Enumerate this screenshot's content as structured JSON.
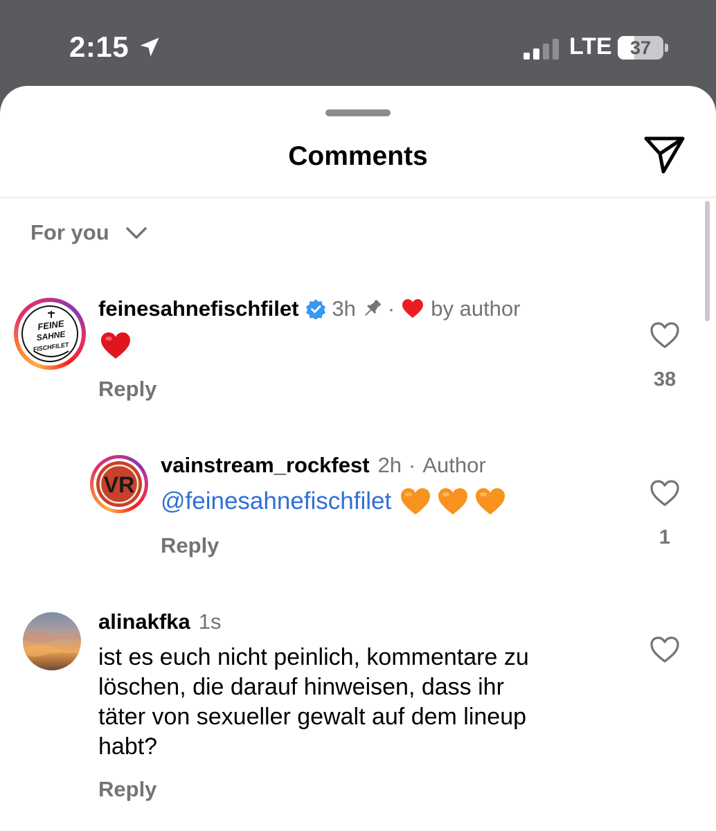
{
  "status_bar": {
    "time": "2:15",
    "location_icon": "location-arrow-icon",
    "signal_icon": "cellular-signal-icon",
    "signal_bars_active": 2,
    "network": "LTE",
    "battery_level": "37",
    "battery_fraction": 0.37
  },
  "sheet": {
    "title": "Comments",
    "share_icon": "paper-plane-icon",
    "sort_label": "For you",
    "sort_icon": "chevron-down-icon"
  },
  "comments": [
    {
      "username": "feinesahnefischfilet",
      "verified": true,
      "time": "3h",
      "pinned": true,
      "separator": "·",
      "liked_by_author_label": "by author",
      "text_emoji": "heart-red",
      "reply_label": "Reply",
      "like_count": "38",
      "avatar_logo_lines": [
        "FEINE",
        "SAHNE",
        "FISCHFILET"
      ],
      "replies": [
        {
          "username": "vainstream_rockfest",
          "time": "2h",
          "separator": "·",
          "badge": "Author",
          "mention": "@feinesahnefischfilet",
          "emojis": [
            "orange-heart",
            "orange-heart",
            "orange-heart"
          ],
          "reply_label": "Reply",
          "like_count": "1",
          "avatar_logo": "VR"
        }
      ]
    },
    {
      "username": "alinakfka",
      "time": "1s",
      "text": "ist es euch nicht peinlich, kommentare zu löschen, die darauf hinweisen, dass ihr täter von sexueller gewalt auf dem lineup habt?",
      "text_lines": [
        "ist es euch nicht peinlich, kommentare zu",
        "löschen, die darauf hinweisen, dass ihr",
        "täter von sexueller gewalt auf dem lineup",
        "habt?"
      ],
      "reply_label": "Reply",
      "like_count": ""
    }
  ],
  "colors": {
    "status_bar_bg": "#5a5b5f",
    "muted_text": "#737378",
    "mention": "#2f6fd6",
    "verified_blue": "#3897f0",
    "heart_red": "#ed1c24",
    "heart_orange": "#f7931e"
  }
}
